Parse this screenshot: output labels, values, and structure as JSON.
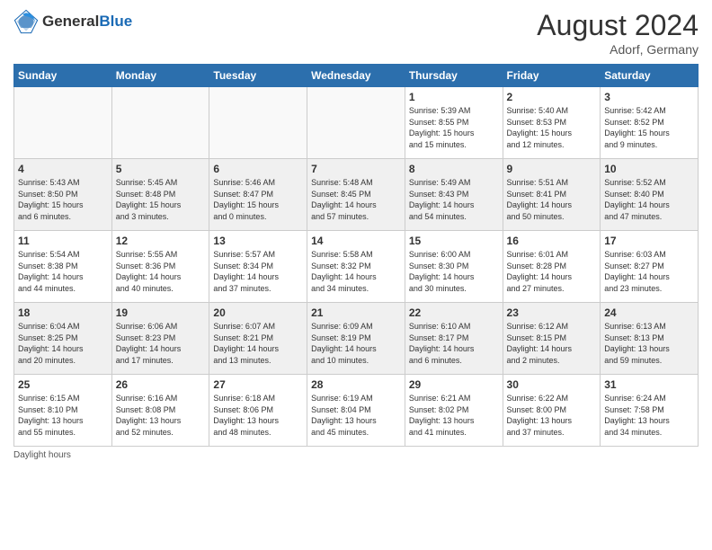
{
  "header": {
    "logo_general": "General",
    "logo_blue": "Blue",
    "month_year": "August 2024",
    "location": "Adorf, Germany"
  },
  "days_of_week": [
    "Sunday",
    "Monday",
    "Tuesday",
    "Wednesday",
    "Thursday",
    "Friday",
    "Saturday"
  ],
  "weeks": [
    [
      {
        "day": "",
        "info": ""
      },
      {
        "day": "",
        "info": ""
      },
      {
        "day": "",
        "info": ""
      },
      {
        "day": "",
        "info": ""
      },
      {
        "day": "1",
        "info": "Sunrise: 5:39 AM\nSunset: 8:55 PM\nDaylight: 15 hours\nand 15 minutes."
      },
      {
        "day": "2",
        "info": "Sunrise: 5:40 AM\nSunset: 8:53 PM\nDaylight: 15 hours\nand 12 minutes."
      },
      {
        "day": "3",
        "info": "Sunrise: 5:42 AM\nSunset: 8:52 PM\nDaylight: 15 hours\nand 9 minutes."
      }
    ],
    [
      {
        "day": "4",
        "info": "Sunrise: 5:43 AM\nSunset: 8:50 PM\nDaylight: 15 hours\nand 6 minutes."
      },
      {
        "day": "5",
        "info": "Sunrise: 5:45 AM\nSunset: 8:48 PM\nDaylight: 15 hours\nand 3 minutes."
      },
      {
        "day": "6",
        "info": "Sunrise: 5:46 AM\nSunset: 8:47 PM\nDaylight: 15 hours\nand 0 minutes."
      },
      {
        "day": "7",
        "info": "Sunrise: 5:48 AM\nSunset: 8:45 PM\nDaylight: 14 hours\nand 57 minutes."
      },
      {
        "day": "8",
        "info": "Sunrise: 5:49 AM\nSunset: 8:43 PM\nDaylight: 14 hours\nand 54 minutes."
      },
      {
        "day": "9",
        "info": "Sunrise: 5:51 AM\nSunset: 8:41 PM\nDaylight: 14 hours\nand 50 minutes."
      },
      {
        "day": "10",
        "info": "Sunrise: 5:52 AM\nSunset: 8:40 PM\nDaylight: 14 hours\nand 47 minutes."
      }
    ],
    [
      {
        "day": "11",
        "info": "Sunrise: 5:54 AM\nSunset: 8:38 PM\nDaylight: 14 hours\nand 44 minutes."
      },
      {
        "day": "12",
        "info": "Sunrise: 5:55 AM\nSunset: 8:36 PM\nDaylight: 14 hours\nand 40 minutes."
      },
      {
        "day": "13",
        "info": "Sunrise: 5:57 AM\nSunset: 8:34 PM\nDaylight: 14 hours\nand 37 minutes."
      },
      {
        "day": "14",
        "info": "Sunrise: 5:58 AM\nSunset: 8:32 PM\nDaylight: 14 hours\nand 34 minutes."
      },
      {
        "day": "15",
        "info": "Sunrise: 6:00 AM\nSunset: 8:30 PM\nDaylight: 14 hours\nand 30 minutes."
      },
      {
        "day": "16",
        "info": "Sunrise: 6:01 AM\nSunset: 8:28 PM\nDaylight: 14 hours\nand 27 minutes."
      },
      {
        "day": "17",
        "info": "Sunrise: 6:03 AM\nSunset: 8:27 PM\nDaylight: 14 hours\nand 23 minutes."
      }
    ],
    [
      {
        "day": "18",
        "info": "Sunrise: 6:04 AM\nSunset: 8:25 PM\nDaylight: 14 hours\nand 20 minutes."
      },
      {
        "day": "19",
        "info": "Sunrise: 6:06 AM\nSunset: 8:23 PM\nDaylight: 14 hours\nand 17 minutes."
      },
      {
        "day": "20",
        "info": "Sunrise: 6:07 AM\nSunset: 8:21 PM\nDaylight: 14 hours\nand 13 minutes."
      },
      {
        "day": "21",
        "info": "Sunrise: 6:09 AM\nSunset: 8:19 PM\nDaylight: 14 hours\nand 10 minutes."
      },
      {
        "day": "22",
        "info": "Sunrise: 6:10 AM\nSunset: 8:17 PM\nDaylight: 14 hours\nand 6 minutes."
      },
      {
        "day": "23",
        "info": "Sunrise: 6:12 AM\nSunset: 8:15 PM\nDaylight: 14 hours\nand 2 minutes."
      },
      {
        "day": "24",
        "info": "Sunrise: 6:13 AM\nSunset: 8:13 PM\nDaylight: 13 hours\nand 59 minutes."
      }
    ],
    [
      {
        "day": "25",
        "info": "Sunrise: 6:15 AM\nSunset: 8:10 PM\nDaylight: 13 hours\nand 55 minutes."
      },
      {
        "day": "26",
        "info": "Sunrise: 6:16 AM\nSunset: 8:08 PM\nDaylight: 13 hours\nand 52 minutes."
      },
      {
        "day": "27",
        "info": "Sunrise: 6:18 AM\nSunset: 8:06 PM\nDaylight: 13 hours\nand 48 minutes."
      },
      {
        "day": "28",
        "info": "Sunrise: 6:19 AM\nSunset: 8:04 PM\nDaylight: 13 hours\nand 45 minutes."
      },
      {
        "day": "29",
        "info": "Sunrise: 6:21 AM\nSunset: 8:02 PM\nDaylight: 13 hours\nand 41 minutes."
      },
      {
        "day": "30",
        "info": "Sunrise: 6:22 AM\nSunset: 8:00 PM\nDaylight: 13 hours\nand 37 minutes."
      },
      {
        "day": "31",
        "info": "Sunrise: 6:24 AM\nSunset: 7:58 PM\nDaylight: 13 hours\nand 34 minutes."
      }
    ]
  ],
  "footer": {
    "daylight_label": "Daylight hours"
  }
}
